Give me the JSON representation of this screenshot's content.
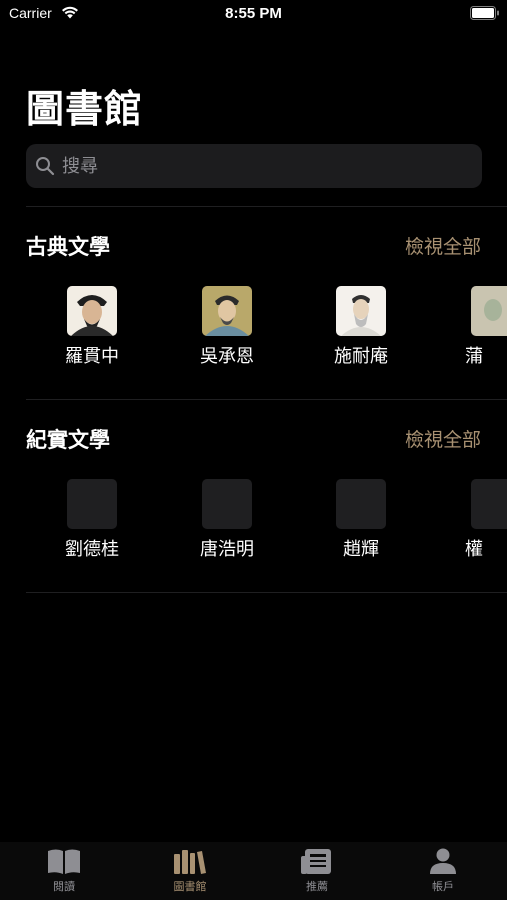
{
  "status_bar": {
    "carrier": "Carrier",
    "time": "8:55 PM"
  },
  "page_title": "圖書館",
  "search": {
    "placeholder": "搜尋"
  },
  "sections": [
    {
      "title": "古典文學",
      "see_all": "檢視全部",
      "authors": [
        {
          "name": "羅貫中"
        },
        {
          "name": "吳承恩"
        },
        {
          "name": "施耐庵"
        },
        {
          "name": "蒲"
        }
      ]
    },
    {
      "title": "紀實文學",
      "see_all": "檢視全部",
      "authors": [
        {
          "name": "劉德桂"
        },
        {
          "name": "唐浩明"
        },
        {
          "name": "趙輝"
        },
        {
          "name": "權"
        }
      ]
    }
  ],
  "tabs": [
    {
      "label": "閱讀",
      "icon": "book-icon",
      "active": false
    },
    {
      "label": "圖書館",
      "icon": "library-icon",
      "active": true
    },
    {
      "label": "推薦",
      "icon": "news-icon",
      "active": false
    },
    {
      "label": "帳戶",
      "icon": "person-icon",
      "active": false
    }
  ],
  "colors": {
    "accent": "#a89172",
    "background": "#000000",
    "search_background": "#1c1c1e",
    "inactive_tab": "#8e8e93"
  }
}
